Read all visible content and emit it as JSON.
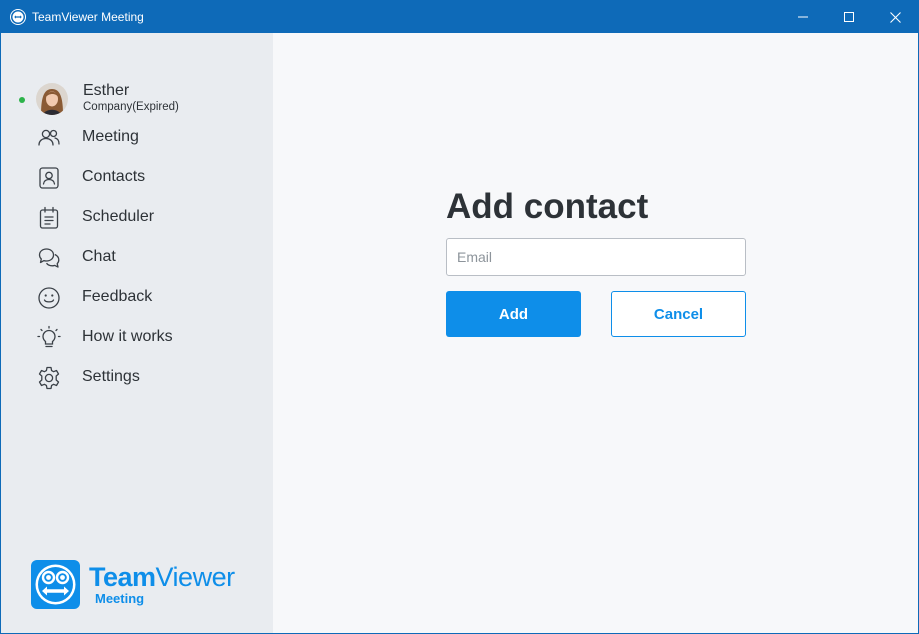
{
  "window": {
    "title": "TeamViewer Meeting"
  },
  "user": {
    "name": "Esther",
    "subtitle": "Company(Expired)",
    "status": "online"
  },
  "nav": {
    "items": [
      {
        "label": "Meeting",
        "icon": "people-icon"
      },
      {
        "label": "Contacts",
        "icon": "contact-card-icon"
      },
      {
        "label": "Scheduler",
        "icon": "calendar-icon"
      },
      {
        "label": "Chat",
        "icon": "chat-bubbles-icon"
      },
      {
        "label": "Feedback",
        "icon": "smiley-icon"
      },
      {
        "label": "How it works",
        "icon": "lightbulb-icon"
      },
      {
        "label": "Settings",
        "icon": "gear-icon"
      }
    ]
  },
  "brand": {
    "name_bold": "Team",
    "name_regular": "Viewer",
    "sub": "Meeting"
  },
  "add_contact": {
    "title": "Add contact",
    "email_placeholder": "Email",
    "email_value": "",
    "add_label": "Add",
    "cancel_label": "Cancel"
  },
  "colors": {
    "titlebar": "#0e6ab8",
    "accent": "#0e8ee9",
    "sidebar_bg": "#e9ecf0",
    "main_bg": "#f7f8fa",
    "presence_online": "#2cb34a"
  }
}
